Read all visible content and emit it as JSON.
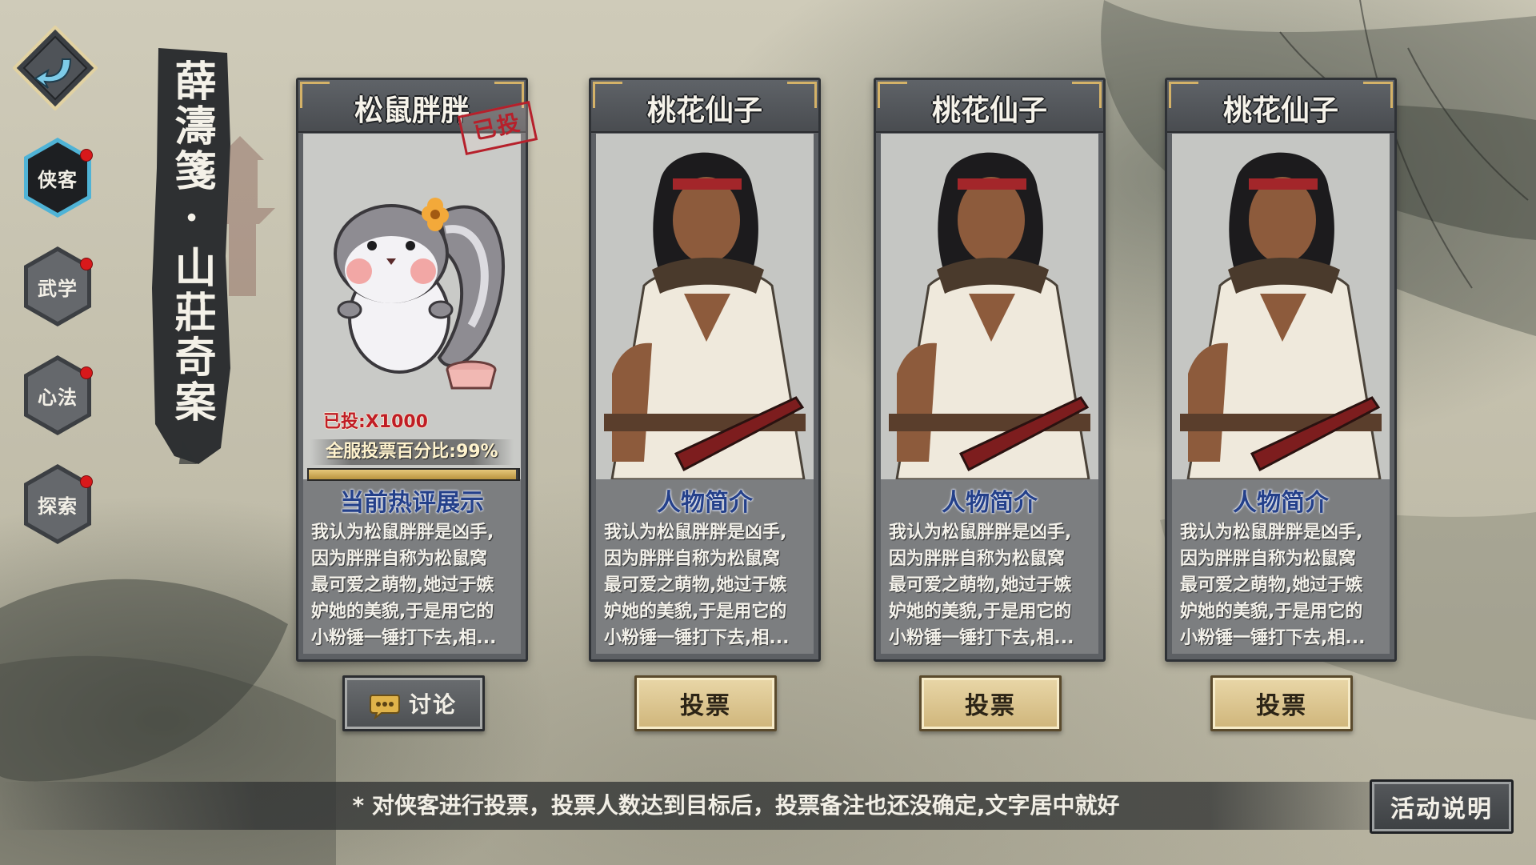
{
  "side_tabs": [
    {
      "label": "侠客",
      "active": true,
      "has_dot": true
    },
    {
      "label": "武学",
      "active": false,
      "has_dot": true
    },
    {
      "label": "心法",
      "active": false,
      "has_dot": true
    },
    {
      "label": "探索",
      "active": false,
      "has_dot": true
    }
  ],
  "banner": {
    "title": "薛濤箋·山莊奇案"
  },
  "cards": [
    {
      "name": "松鼠胖胖",
      "stamp": "已投",
      "voted_count": "已投:X1000",
      "vote_percent": "全服投票百分比:99%",
      "progress": 0.99,
      "section_title": "当前热评展示",
      "description": "我认为松鼠胖胖是凶手,\n因为胖胖自称为松鼠窝\n最可爱之萌物,她过于嫉\n妒她的美貌,于是用它的\n小粉锤一锤打下去,相...",
      "button_label": "讨论",
      "button_icon": "chat-bubble-icon"
    },
    {
      "name": "桃花仙子",
      "section_title": "人物简介",
      "description": "我认为松鼠胖胖是凶手,\n因为胖胖自称为松鼠窝\n最可爱之萌物,她过于嫉\n妒她的美貌,于是用它的\n小粉锤一锤打下去,相...",
      "button_label": "投票"
    },
    {
      "name": "桃花仙子",
      "section_title": "人物简介",
      "description": "我认为松鼠胖胖是凶手,\n因为胖胖自称为松鼠窝\n最可爱之萌物,她过于嫉\n妒她的美貌,于是用它的\n小粉锤一锤打下去,相...",
      "button_label": "投票"
    },
    {
      "name": "桃花仙子",
      "section_title": "人物简介",
      "description": "我认为松鼠胖胖是凶手,\n因为胖胖自称为松鼠窝\n最可爱之萌物,她过于嫉\n妒她的美貌,于是用它的\n小粉锤一锤打下去,相...",
      "button_label": "投票"
    }
  ],
  "notice": "* 对侠客进行投票，投票人数达到目标后，投票备注也还没确定,文字居中就好",
  "help_button": "活动说明",
  "colors": {
    "accent_gold": "#d4b268",
    "red_dot": "#d8191b",
    "section_blue": "#24408a",
    "stamp_red": "#b6202b"
  }
}
